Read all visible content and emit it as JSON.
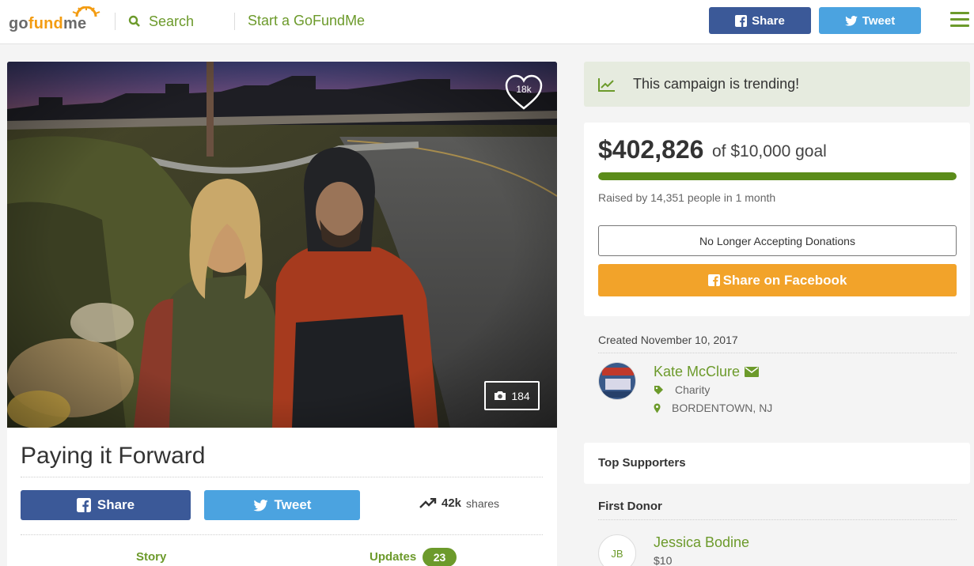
{
  "header": {
    "logo": "gofundme",
    "search_label": "Search",
    "start_label": "Start a GoFundMe",
    "share_label": "Share",
    "tweet_label": "Tweet"
  },
  "campaign": {
    "title": "Paying it Forward",
    "likes": "18k",
    "photo_count": "184",
    "share_label": "Share",
    "tweet_label": "Tweet",
    "shares_count": "42k",
    "shares_suffix": "shares",
    "tabs": [
      {
        "label": "Story"
      },
      {
        "label": "Updates",
        "badge": "23"
      }
    ]
  },
  "sidebar": {
    "trending_text": "This campaign is trending!",
    "raised_amount": "$402,826",
    "goal_text": "of $10,000 goal",
    "progress_fraction": 1.0,
    "raised_by": "Raised by 14,351 people in 1 month",
    "closed_label": "No Longer Accepting Donations",
    "share_facebook_label": "Share on Facebook",
    "created": "Created November 10, 2017",
    "organizer": {
      "name": "Kate McClure",
      "category": "Charity",
      "location": "BORDENTOWN, NJ"
    },
    "top_supporters_label": "Top Supporters",
    "first_donor_label": "First Donor",
    "first_donor": {
      "initials": "JB",
      "name": "Jessica Bodine",
      "amount": "$10"
    }
  },
  "colors": {
    "brand_green": "#6c9a2b",
    "facebook": "#3b5998",
    "twitter": "#4ba3e0",
    "orange": "#f2a32a"
  }
}
